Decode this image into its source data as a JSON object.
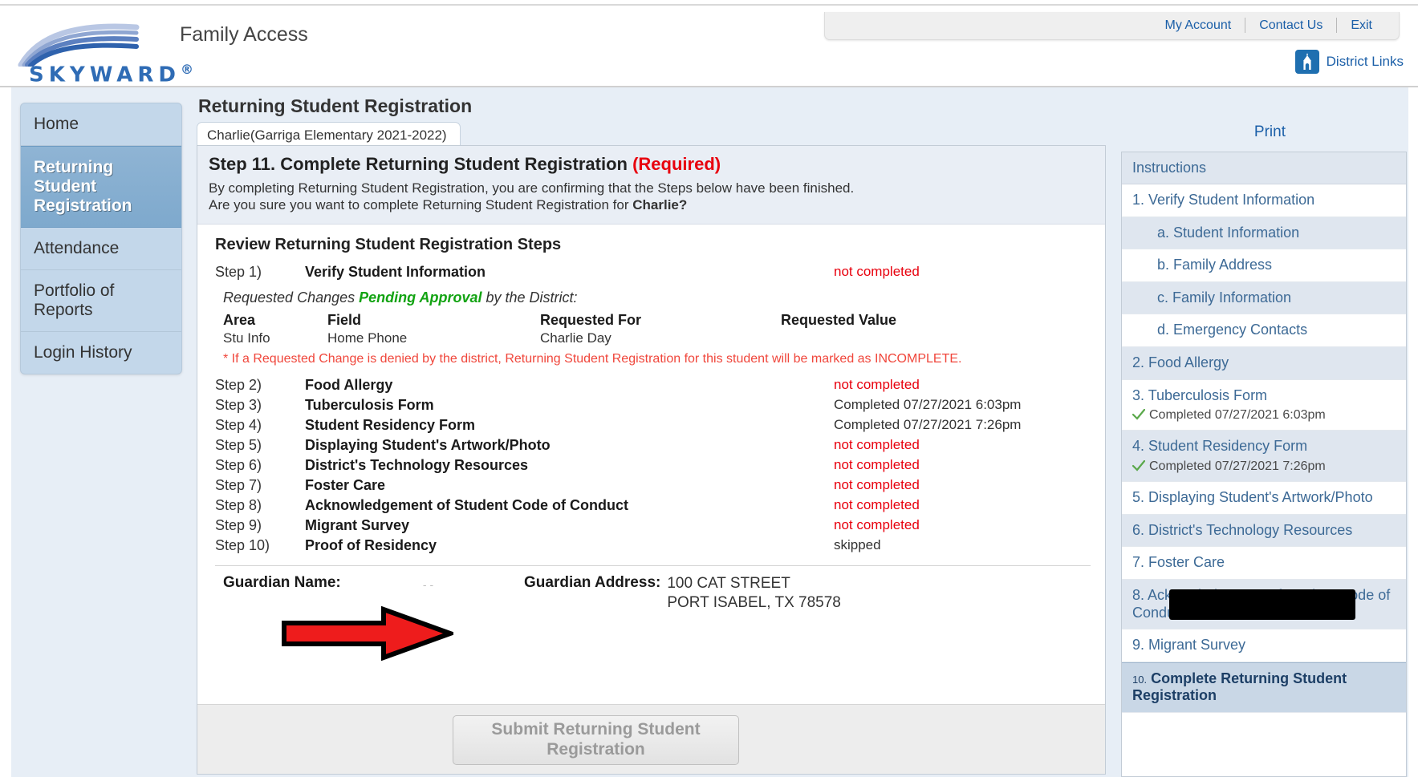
{
  "header": {
    "brand": "SKYWARD",
    "brand_reg": "®",
    "app_title": "Family Access",
    "account_links": [
      {
        "label": "My Account"
      },
      {
        "label": "Contact Us"
      },
      {
        "label": "Exit"
      }
    ],
    "district_links_label": "District Links"
  },
  "sidebar": {
    "items": [
      {
        "label": "Home",
        "active": false
      },
      {
        "label": "Returning Student Registration",
        "active": true
      },
      {
        "label": "Attendance",
        "active": false
      },
      {
        "label": "Portfolio of Reports",
        "active": false
      },
      {
        "label": "Login History",
        "active": false
      }
    ]
  },
  "main": {
    "page_title": "Returning Student Registration",
    "tab_label": "Charlie(Garriga Elementary 2021-2022)",
    "print_label": "Print",
    "step_heading": "Step 11. Complete Returning Student Registration",
    "step_required": "(Required)",
    "intro_line1": "By completing Returning Student Registration, you are confirming that the Steps below have been finished.",
    "intro_line2_pre": "Are you sure you want to complete Returning Student Registration for ",
    "intro_student": "Charlie?",
    "review_title": "Review Returning Student Registration Steps",
    "step1": {
      "number": "Step 1)",
      "name": "Verify Student Information",
      "status": "not completed"
    },
    "pending_pre": "Requested Changes ",
    "pending_em": "Pending Approval",
    "pending_post": " by the District:",
    "changes_headers": [
      "Area",
      "Field",
      "Requested For",
      "Requested Value"
    ],
    "changes_rows": [
      {
        "area": "Stu Info",
        "field": "Home Phone",
        "requested_for": "Charlie Day",
        "requested_value": ""
      }
    ],
    "deny_note": "* If a Requested Change is denied by the district, Returning Student Registration for this student will be marked as INCOMPLETE.",
    "steps": [
      {
        "number": "Step 2)",
        "name": "Food Allergy",
        "status": "not completed",
        "incomplete": true
      },
      {
        "number": "Step 3)",
        "name": "Tuberculosis Form",
        "status": "Completed 07/27/2021 6:03pm",
        "incomplete": false
      },
      {
        "number": "Step 4)",
        "name": "Student Residency Form",
        "status": "Completed 07/27/2021 7:26pm",
        "incomplete": false
      },
      {
        "number": "Step 5)",
        "name": "Displaying Student's Artwork/Photo",
        "status": "not completed",
        "incomplete": true
      },
      {
        "number": "Step 6)",
        "name": "District's Technology Resources",
        "status": "not completed",
        "incomplete": true
      },
      {
        "number": "Step 7)",
        "name": "Foster Care",
        "status": "not completed",
        "incomplete": true
      },
      {
        "number": "Step 8)",
        "name": "Acknowledgement of Student Code of Conduct",
        "status": "not completed",
        "incomplete": true
      },
      {
        "number": "Step 9)",
        "name": "Migrant Survey",
        "status": "not completed",
        "incomplete": true
      },
      {
        "number": "Step 10)",
        "name": "Proof of Residency",
        "status": "skipped",
        "incomplete": false
      }
    ],
    "guardian_name_label": "Guardian Name:",
    "guardian_name_value": "",
    "guardian_address_label": "Guardian Address:",
    "guardian_address_line1": "100 CAT STREET",
    "guardian_address_line2": "PORT ISABEL, TX 78578",
    "submit_label": "Submit Returning Student Registration"
  },
  "instructions": {
    "title": "Instructions",
    "items": [
      {
        "label": "1. Verify Student Information",
        "sub": false,
        "alt": false,
        "done": ""
      },
      {
        "label": "a. Student Information",
        "sub": true,
        "alt": true,
        "done": ""
      },
      {
        "label": "b. Family Address",
        "sub": true,
        "alt": false,
        "done": ""
      },
      {
        "label": "c. Family Information",
        "sub": true,
        "alt": true,
        "done": ""
      },
      {
        "label": "d. Emergency Contacts",
        "sub": true,
        "alt": false,
        "done": ""
      },
      {
        "label": "2. Food Allergy",
        "sub": false,
        "alt": true,
        "done": ""
      },
      {
        "label": "3. Tuberculosis Form",
        "sub": false,
        "alt": false,
        "done": "Completed 07/27/2021 6:03pm"
      },
      {
        "label": "4. Student Residency Form",
        "sub": false,
        "alt": true,
        "done": "Completed 07/27/2021 7:26pm"
      },
      {
        "label": "5. Displaying Student's Artwork/Photo",
        "sub": false,
        "alt": false,
        "done": ""
      },
      {
        "label": "6. District's Technology Resources",
        "sub": false,
        "alt": true,
        "done": ""
      },
      {
        "label": "7. Foster Care",
        "sub": false,
        "alt": false,
        "done": ""
      },
      {
        "label": "8. Acknowledgement of Student Code of Conduct",
        "sub": false,
        "alt": true,
        "done": ""
      },
      {
        "label": "9. Migrant Survey",
        "sub": false,
        "alt": false,
        "done": ""
      }
    ],
    "current_number": "10.",
    "current_label": "Complete Returning Student Registration"
  },
  "colors": {
    "link_blue": "#1b5fa8",
    "required_red": "#e8000d",
    "approved_green": "#12a312",
    "accent_panel": "#dfe6ef",
    "arrow_red": "#ee1c1c"
  }
}
